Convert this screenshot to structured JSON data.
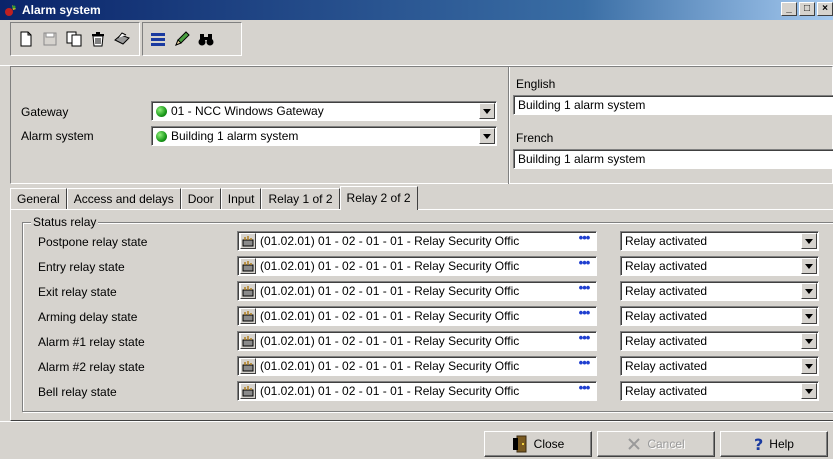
{
  "window": {
    "title": "Alarm system",
    "controls": [
      "_",
      "□",
      "×"
    ]
  },
  "toolbar": {
    "icons": [
      "new-icon",
      "save-icon",
      "copy-icon",
      "delete-icon",
      "print-icon",
      "list-icon",
      "pencil-icon",
      "binoculars-icon"
    ]
  },
  "header": {
    "gateway_label": "Gateway",
    "gateway_value": "01 - NCC Windows Gateway",
    "alarm_label": "Alarm system",
    "alarm_value": "Building 1 alarm system",
    "english_label": "English",
    "english_value": "Building 1 alarm system",
    "french_label": "French",
    "french_value": "Building 1 alarm system"
  },
  "tabs": [
    {
      "label": "General"
    },
    {
      "label": "Access and delays"
    },
    {
      "label": "Door"
    },
    {
      "label": "Input"
    },
    {
      "label": "Relay 1 of 2"
    },
    {
      "label": "Relay 2 of 2"
    }
  ],
  "active_tab": "Relay 2 of 2",
  "status_relay": {
    "legend": "Status relay",
    "rows": [
      {
        "label": "Postpone relay state",
        "relay": "(01.02.01) 01 - 02 - 01 - 01 - Relay Security Offic",
        "state": "Relay activated"
      },
      {
        "label": "Entry relay state",
        "relay": "(01.02.01) 01 - 02 - 01 - 01 - Relay Security Offic",
        "state": "Relay activated"
      },
      {
        "label": "Exit relay state",
        "relay": "(01.02.01) 01 - 02 - 01 - 01 - Relay Security Offic",
        "state": "Relay activated"
      },
      {
        "label": "Arming delay state",
        "relay": "(01.02.01) 01 - 02 - 01 - 01 - Relay Security Offic",
        "state": "Relay activated"
      },
      {
        "label": "Alarm #1 relay state",
        "relay": "(01.02.01) 01 - 02 - 01 - 01 - Relay Security Offic",
        "state": "Relay activated"
      },
      {
        "label": "Alarm #2 relay state",
        "relay": "(01.02.01) 01 - 02 - 01 - 01 - Relay Security Offic",
        "state": "Relay activated"
      },
      {
        "label": "Bell relay state",
        "relay": "(01.02.01) 01 - 02 - 01 - 01 - Relay Security Offic",
        "state": "Relay activated"
      }
    ]
  },
  "footer": {
    "close_label": "Close",
    "cancel_label": "Cancel",
    "help_label": "Help"
  },
  "colors": {
    "title_bar": "#0a246a",
    "status_dot": "#1a9a1a",
    "ellipsis": "#1f3fd0"
  }
}
